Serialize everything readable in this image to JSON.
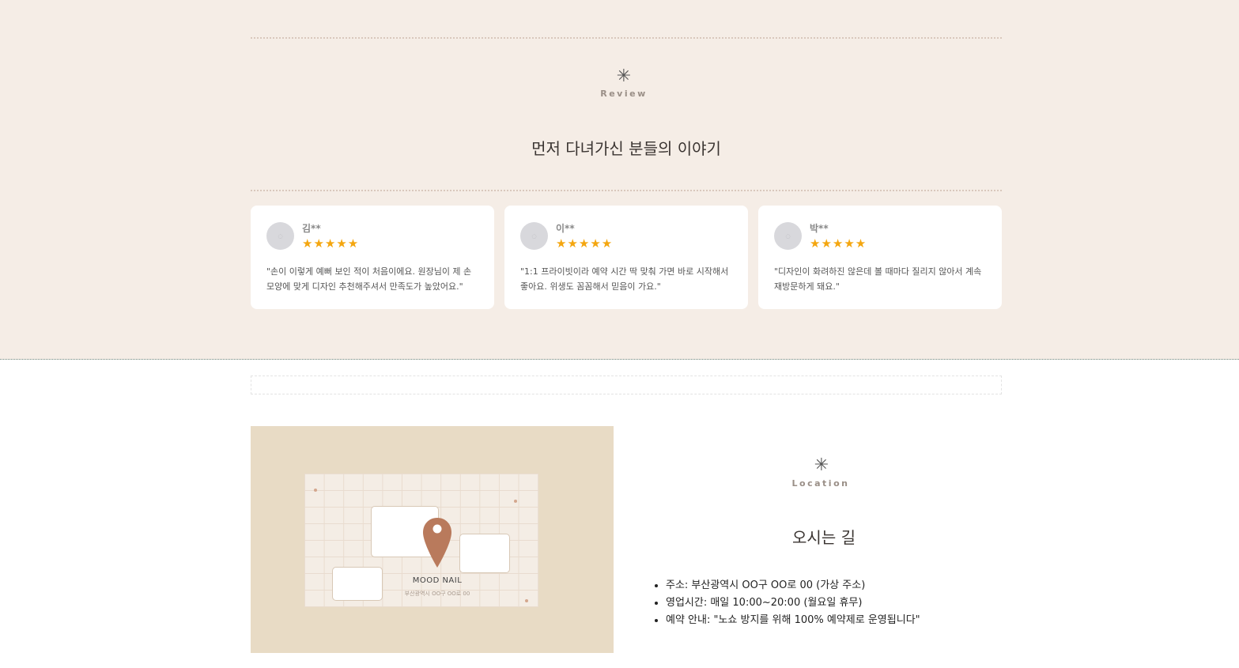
{
  "review": {
    "icon": "✳",
    "label": "Review",
    "title": "먼저 다녀가신 분들의 이야기",
    "cards": [
      {
        "name": "김**",
        "stars": "★★★★★",
        "text": "\"손이 이렇게 예뻐 보인 적이 처음이에요. 원장님이 제 손 모양에 맞게 디자인 추천해주셔서 만족도가 높았어요.\""
      },
      {
        "name": "이**",
        "stars": "★★★★★",
        "text": "\"1:1 프라이빗이라 예약 시간 딱 맞춰 가면 바로 시작해서 좋아요. 위생도 꼼꼼해서 믿음이 가요.\""
      },
      {
        "name": "박**",
        "stars": "★★★★★",
        "text": "\"디자인이 화려하진 않은데 볼 때마다 질리지 않아서 계속 재방문하게 돼요.\""
      }
    ]
  },
  "location": {
    "icon": "✳",
    "label": "Location",
    "title": "오시는 길",
    "map_name": "MOOD NAIL",
    "map_address": "부산광역시 OO구 OO로 00",
    "info": [
      "주소: 부산광역시 OO구 OO로 00 (가상 주소)",
      "영업시간: 매일 10:00~20:00 (월요일 휴무)",
      "예약 안내: \"노쇼 방지를 위해 100% 예약제로 운영됩니다\""
    ]
  },
  "colors": {
    "review_bg": "#f5ede6",
    "star": "#f4a60f",
    "pin": "#b97a5c",
    "map_bg": "#e8dbc5"
  }
}
